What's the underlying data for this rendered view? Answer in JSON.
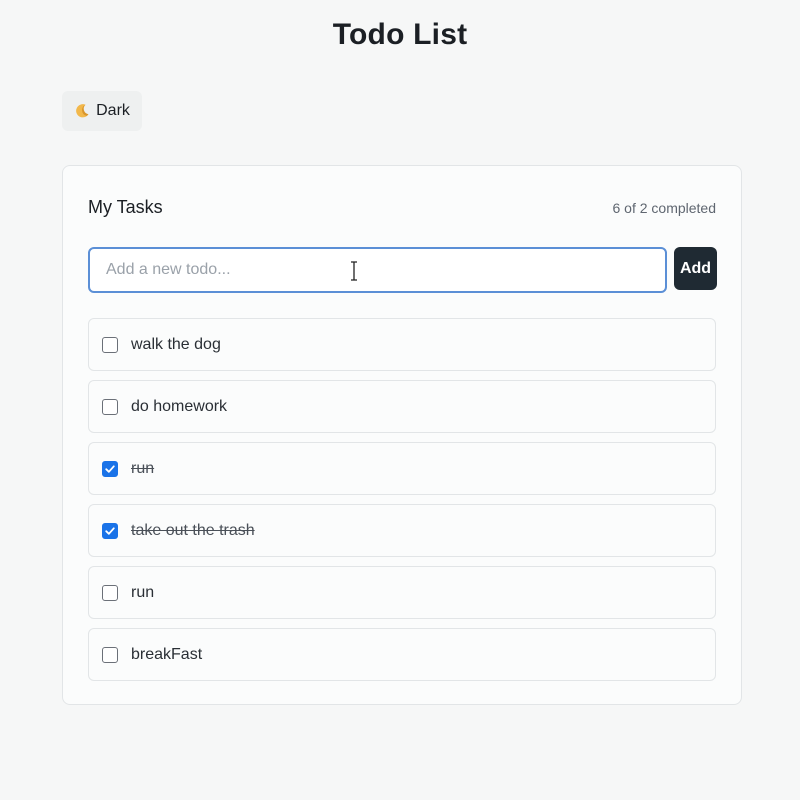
{
  "header": {
    "title": "Todo List"
  },
  "theme_toggle": {
    "label": "Dark",
    "icon": "moon-icon"
  },
  "card": {
    "title": "My Tasks",
    "completed_text": "6 of 2 completed"
  },
  "new_todo": {
    "placeholder": "Add a new todo...",
    "value": "",
    "add_label": "Add"
  },
  "todos": [
    {
      "text": "walk the dog",
      "completed": false
    },
    {
      "text": "do homework",
      "completed": false
    },
    {
      "text": "run",
      "completed": true
    },
    {
      "text": "take out the trash",
      "completed": true
    },
    {
      "text": "run",
      "completed": false
    },
    {
      "text": "breakFast",
      "completed": false
    }
  ],
  "colors": {
    "accent": "#1a73e8",
    "input_focus_border": "#5b8fd6",
    "add_button_bg": "#1f2a33",
    "page_bg": "#f6f7f7"
  }
}
